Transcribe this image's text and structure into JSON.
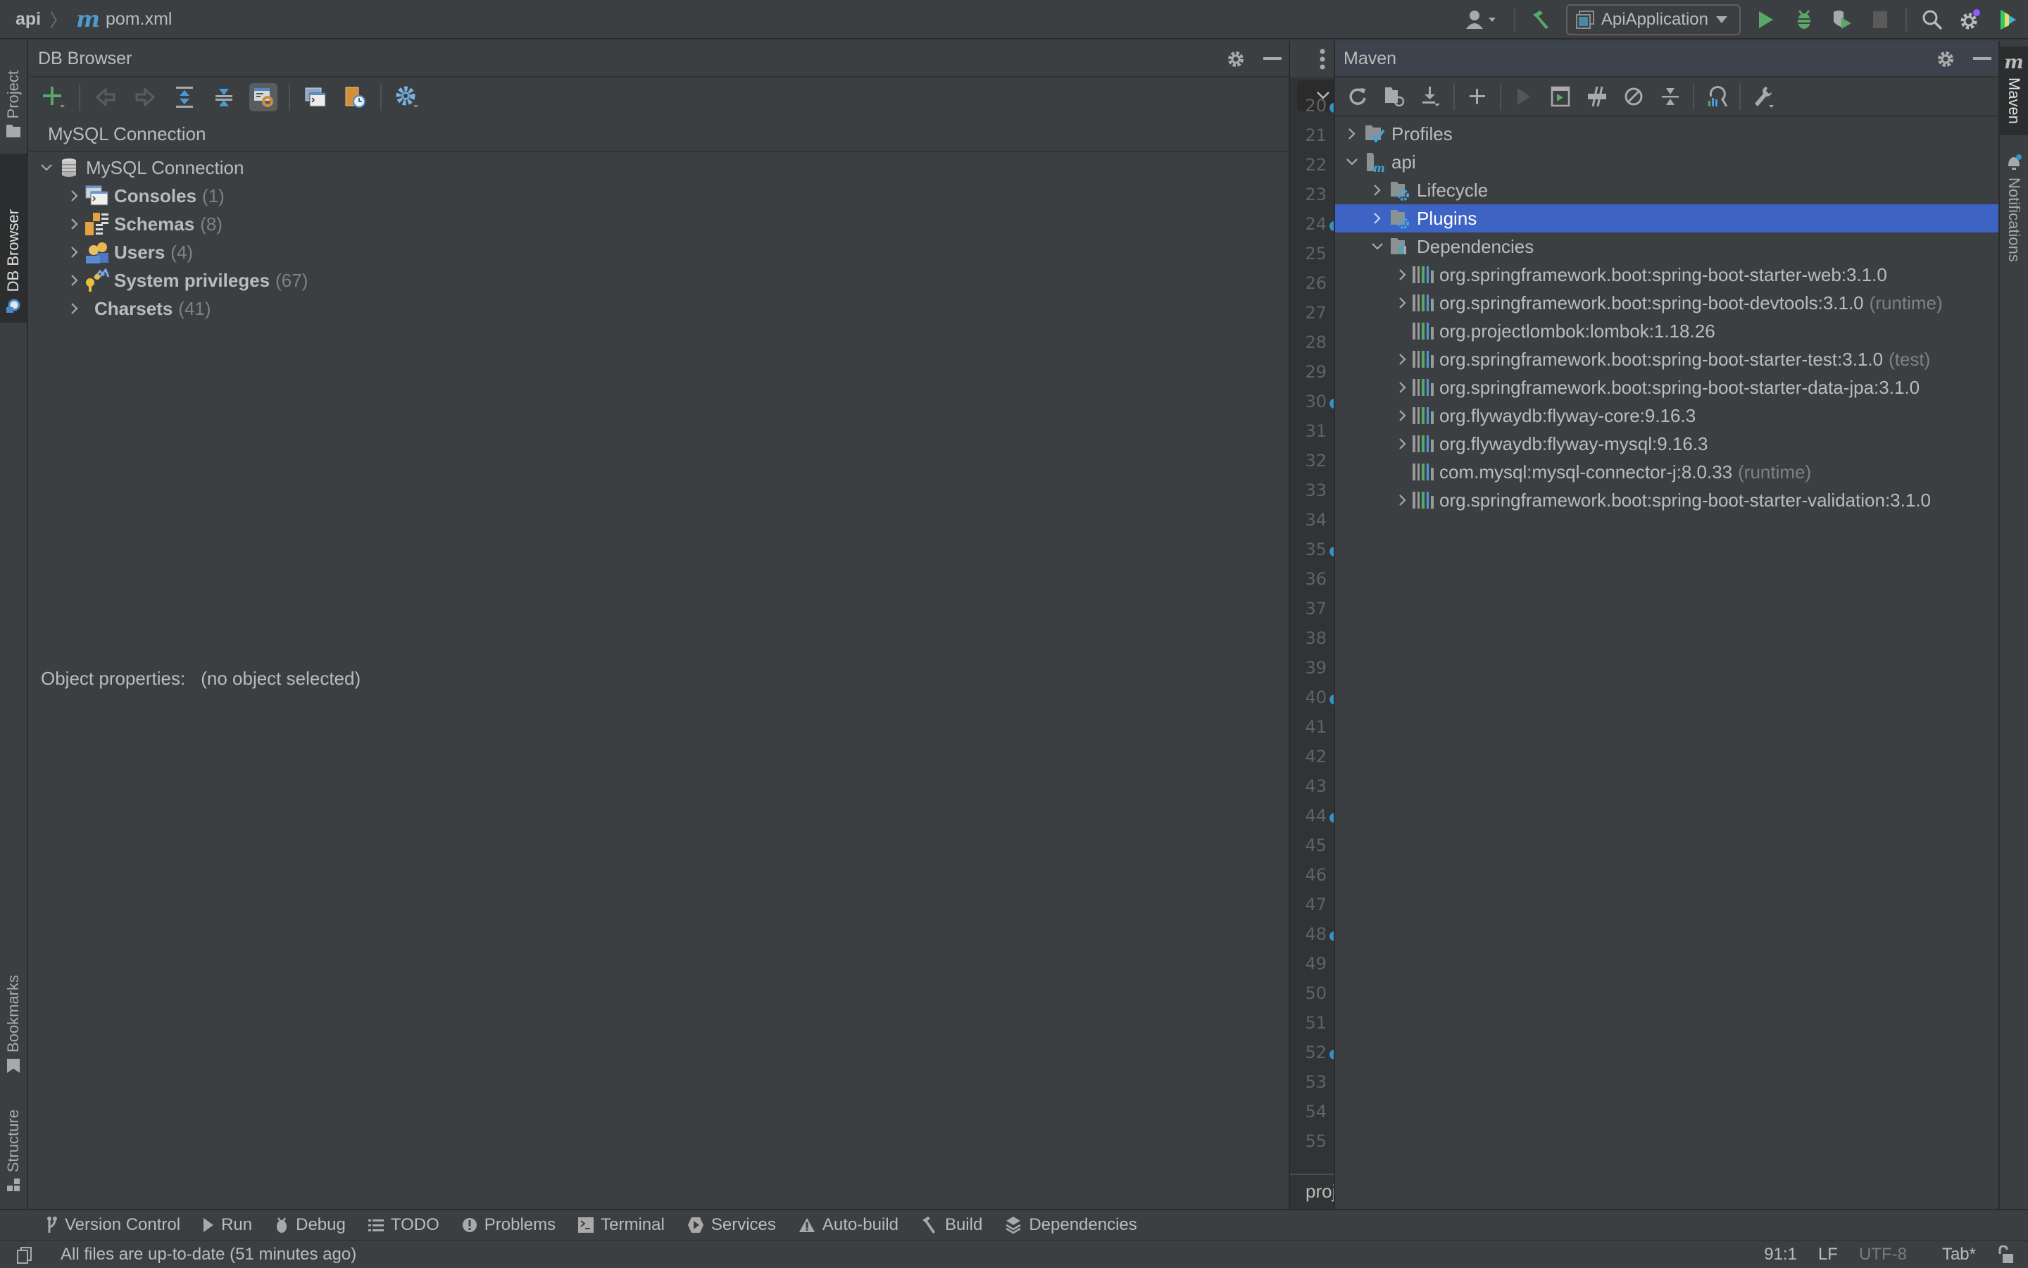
{
  "navbar": {
    "breadcrumbs": [
      "api",
      "pom.xml"
    ],
    "file_icon": "maven-m-icon",
    "run_config": "ApiApplication",
    "actions": [
      "vcs-user-icon",
      "build-hammer-icon",
      "run-icon",
      "debug-icon",
      "coverage-icon",
      "stop-icon",
      "search-icon",
      "settings-icon",
      "toolbox-icon"
    ]
  },
  "left_stripe": {
    "top": [
      {
        "label": "Project",
        "active": false
      },
      {
        "label": "DB Browser",
        "active": true
      }
    ],
    "bottom": [
      {
        "label": "Bookmarks"
      },
      {
        "label": "Structure"
      }
    ]
  },
  "right_stripe": {
    "items": [
      {
        "label": "Maven",
        "active": true
      },
      {
        "label": "Notifications",
        "active": false
      }
    ]
  },
  "db_browser": {
    "title": "DB Browser",
    "connection_selector": "MySQL Connection",
    "tree": {
      "root": "MySQL Connection",
      "children": [
        {
          "label": "Consoles",
          "count": "(1)",
          "icon": "consoles-icon"
        },
        {
          "label": "Schemas",
          "count": "(8)",
          "icon": "schemas-icon"
        },
        {
          "label": "Users",
          "count": "(4)",
          "icon": "users-icon"
        },
        {
          "label": "System privileges",
          "count": "(67)",
          "icon": "privileges-icon"
        },
        {
          "label": "Charsets",
          "count": "(41)",
          "icon": ""
        }
      ]
    },
    "object_properties_label": "Object properties:",
    "object_properties_value": "(no object selected)"
  },
  "editor_gutter": {
    "line_numbers": [
      "20",
      "21",
      "22",
      "23",
      "24",
      "25",
      "26",
      "27",
      "28",
      "29",
      "30",
      "31",
      "32",
      "33",
      "34",
      "35",
      "36",
      "37",
      "38",
      "39",
      "40",
      "41",
      "42",
      "43",
      "44",
      "45",
      "46",
      "47",
      "48",
      "49",
      "50",
      "51",
      "52",
      "53",
      "54",
      "55"
    ],
    "marked_lines": [
      "20",
      "24",
      "30",
      "35",
      "40",
      "44",
      "48",
      "52"
    ],
    "bottom_tab": "proj"
  },
  "maven": {
    "title": "Maven",
    "tree": {
      "profiles": "Profiles",
      "project": "api",
      "lifecycle": "Lifecycle",
      "plugins": "Plugins",
      "dependencies_label": "Dependencies",
      "dependencies": [
        {
          "name": "org.springframework.boot:spring-boot-starter-web:3.1.0",
          "scope": "",
          "expandable": true
        },
        {
          "name": "org.springframework.boot:spring-boot-devtools:3.1.0",
          "scope": "(runtime)",
          "expandable": true
        },
        {
          "name": "org.projectlombok:lombok:1.18.26",
          "scope": "",
          "expandable": false
        },
        {
          "name": "org.springframework.boot:spring-boot-starter-test:3.1.0",
          "scope": "(test)",
          "expandable": true
        },
        {
          "name": "org.springframework.boot:spring-boot-starter-data-jpa:3.1.0",
          "scope": "",
          "expandable": true
        },
        {
          "name": "org.flywaydb:flyway-core:9.16.3",
          "scope": "",
          "expandable": true
        },
        {
          "name": "org.flywaydb:flyway-mysql:9.16.3",
          "scope": "",
          "expandable": true
        },
        {
          "name": "com.mysql:mysql-connector-j:8.0.33",
          "scope": "(runtime)",
          "expandable": false
        },
        {
          "name": "org.springframework.boot:spring-boot-starter-validation:3.1.0",
          "scope": "",
          "expandable": true
        }
      ]
    },
    "selected": "Plugins"
  },
  "bottom_tools": [
    {
      "label": "Version Control",
      "icon": "branch-icon"
    },
    {
      "label": "Run",
      "icon": "run-icon"
    },
    {
      "label": "Debug",
      "icon": "bug-icon"
    },
    {
      "label": "TODO",
      "icon": "list-icon"
    },
    {
      "label": "Problems",
      "icon": "problems-icon"
    },
    {
      "label": "Terminal",
      "icon": "terminal-icon"
    },
    {
      "label": "Services",
      "icon": "services-icon"
    },
    {
      "label": "Auto-build",
      "icon": "warning-icon"
    },
    {
      "label": "Build",
      "icon": "hammer-icon"
    },
    {
      "label": "Dependencies",
      "icon": "layers-icon"
    }
  ],
  "status": {
    "message": "All files are up-to-date (51 minutes ago)",
    "position": "91:1",
    "line_ending": "LF",
    "encoding": "UTF-8",
    "indent": "Tab*"
  },
  "colors": {
    "selection": "#3d63c4",
    "accent_blue": "#3592c4",
    "run_green": "#59a869"
  }
}
